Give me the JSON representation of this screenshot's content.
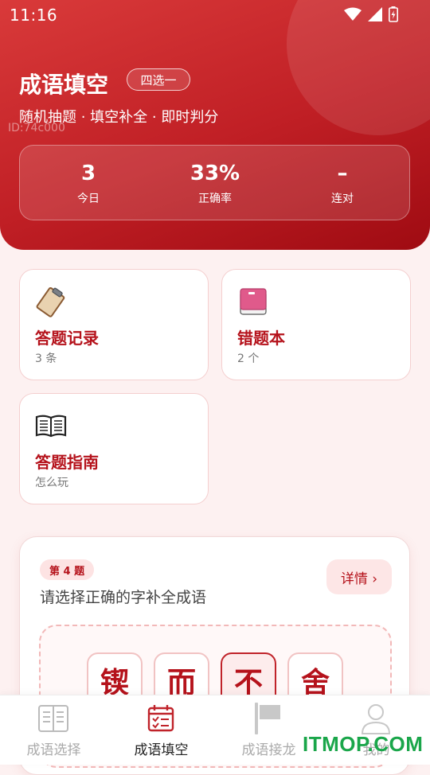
{
  "status_bar": {
    "time": "11:16"
  },
  "header": {
    "title": "成语填空",
    "mode_badge": "四选一",
    "subtitle": "随机抽题 · 填空补全 · 即时判分",
    "id_tag": "ID:74c000",
    "stats": [
      {
        "value": "3",
        "label": "今日"
      },
      {
        "value": "33%",
        "label": "正确率"
      },
      {
        "value": "–",
        "label": "连对"
      }
    ]
  },
  "cards": {
    "records": {
      "title": "答题记录",
      "sub": "3 条",
      "icon": "clipboard-icon"
    },
    "mistakes": {
      "title": "错题本",
      "sub": "2 个",
      "icon": "book-icon"
    },
    "guide": {
      "title": "答题指南",
      "sub": "怎么玩",
      "icon": "open-book-icon"
    }
  },
  "question": {
    "number_label": "第 4 题",
    "prompt": "请选择正确的字补全成语",
    "detail_label": "详情 ›",
    "chars": [
      "锲",
      "而",
      "不",
      "舍"
    ],
    "blank_index": 2
  },
  "bottom_nav": [
    {
      "label": "成语选择",
      "icon": "panel-icon",
      "active": false
    },
    {
      "label": "成语填空",
      "icon": "calendar-icon",
      "active": true
    },
    {
      "label": "成语接龙",
      "icon": "flag-icon",
      "active": false
    },
    {
      "label": "我的",
      "icon": "person-icon",
      "active": false
    }
  ],
  "watermark": "ITMOP.COM",
  "colors": {
    "primary": "#c01f25",
    "accent_text": "#b5121b",
    "bg": "#fdf1f1"
  }
}
